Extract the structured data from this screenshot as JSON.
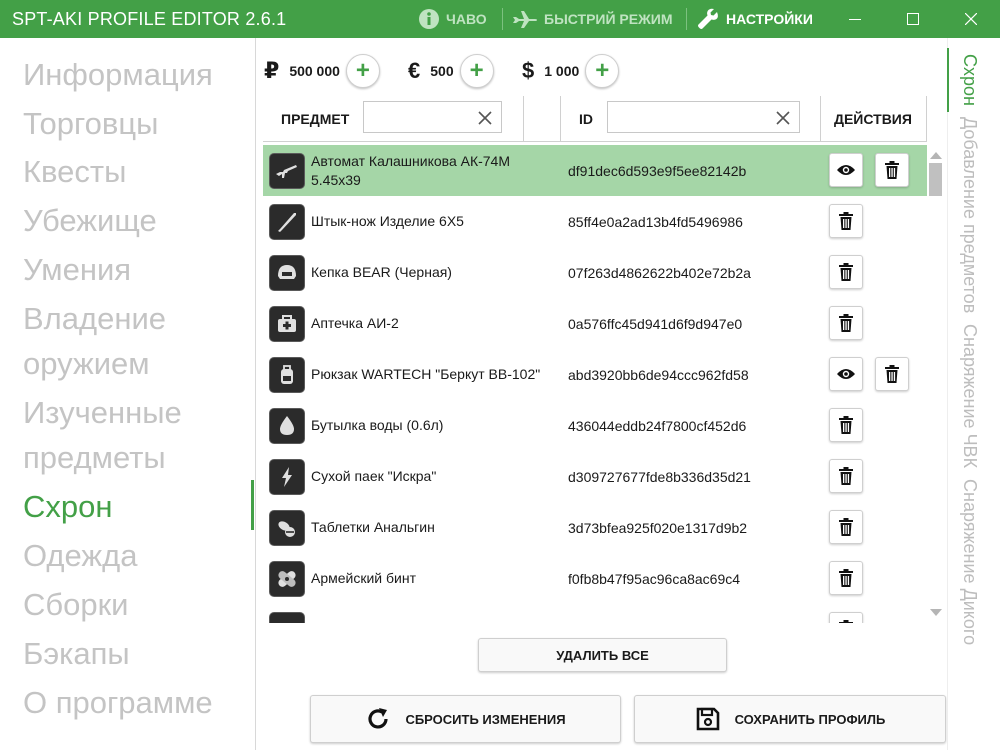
{
  "titlebar": {
    "title": "SPT-AKI PROFILE EDITOR  2.6.1",
    "faq": "ЧАВО",
    "fast_mode": "БЫСТРИЙ РЕЖИМ",
    "settings": "НАСТРОЙКИ",
    "colors": {
      "bar": "#43a047"
    }
  },
  "sidebar": {
    "items": [
      {
        "label": "Информация"
      },
      {
        "label": "Торговцы"
      },
      {
        "label": "Квесты"
      },
      {
        "label": "Убежище"
      },
      {
        "label": "Умения"
      },
      {
        "label": "Владение"
      },
      {
        "label": "оружием"
      },
      {
        "label": "Изученные"
      },
      {
        "label": "предметы"
      },
      {
        "label": "Схрон"
      },
      {
        "label": "Одежда"
      },
      {
        "label": "Сборки"
      },
      {
        "label": "Бэкапы"
      },
      {
        "label": "О программе"
      }
    ],
    "active": "Схрон"
  },
  "currency": [
    {
      "symbol": "₽",
      "value": "500 000"
    },
    {
      "symbol": "€",
      "value": "500"
    },
    {
      "symbol": "$",
      "value": "1 000"
    }
  ],
  "table": {
    "col_item": "ПРЕДМЕТ",
    "col_id": "ID",
    "col_actions": "ДЕЙСТВИЯ",
    "item_filter": "",
    "id_filter": "",
    "rows": [
      {
        "name": "Автомат Калашникова АК-74М 5.45x39",
        "id": "df91dec6d593e9f5ee82142b",
        "icon": "rifle-icon",
        "view": true,
        "selected": true
      },
      {
        "name": "Штык-нож Изделие 6Х5",
        "id": "85ff4e0a2ad13b4fd5496986",
        "icon": "knife-icon",
        "view": false
      },
      {
        "name": "Кепка BEAR (Черная)",
        "id": "07f263d4862622b402e72b2a",
        "icon": "helmet-icon",
        "view": false
      },
      {
        "name": "Аптечка АИ-2",
        "id": "0a576ffc45d941d6f9d947e0",
        "icon": "medkit-icon",
        "view": false
      },
      {
        "name": "Рюкзак WARTECH \"Беркут ВВ-102\"",
        "id": "abd3920bb6de94ccc962fd58",
        "icon": "backpack-icon",
        "view": true
      },
      {
        "name": "Бутылка воды (0.6л)",
        "id": "436044eddb24f7800cf452d6",
        "icon": "water-drop-icon",
        "view": false
      },
      {
        "name": "Сухой паек \"Искра\"",
        "id": "d309727677fde8b336d35d21",
        "icon": "lightning-icon",
        "view": false
      },
      {
        "name": "Таблетки Анальгин",
        "id": "3d73bfea925f020e1317d9b2",
        "icon": "pills-icon",
        "view": false
      },
      {
        "name": "Армейский бинт",
        "id": "f0fb8b47f95ac96ca8ac69c4",
        "icon": "bandage-icon",
        "view": false
      },
      {
        "name": "",
        "id": "",
        "icon": "item-icon",
        "view": false
      }
    ]
  },
  "buttons": {
    "delete_all": "УДАЛИТЬ ВСЕ",
    "reset": "СБРОСИТЬ ИЗМЕНЕНИЯ",
    "save": "СОХРАНИТЬ ПРОФИЛЬ"
  },
  "vertical_tabs": [
    {
      "label": "Схрон",
      "active": true
    },
    {
      "label": "Добавление предметов",
      "active": false
    },
    {
      "label": "Снаряжение ЧВК",
      "active": false
    },
    {
      "label": "Снаряжение Дикого",
      "active": false
    }
  ],
  "colors": {
    "accent": "#43a047",
    "selected_row": "#a5d6a7",
    "nav_inactive": "#c4c4c4"
  }
}
